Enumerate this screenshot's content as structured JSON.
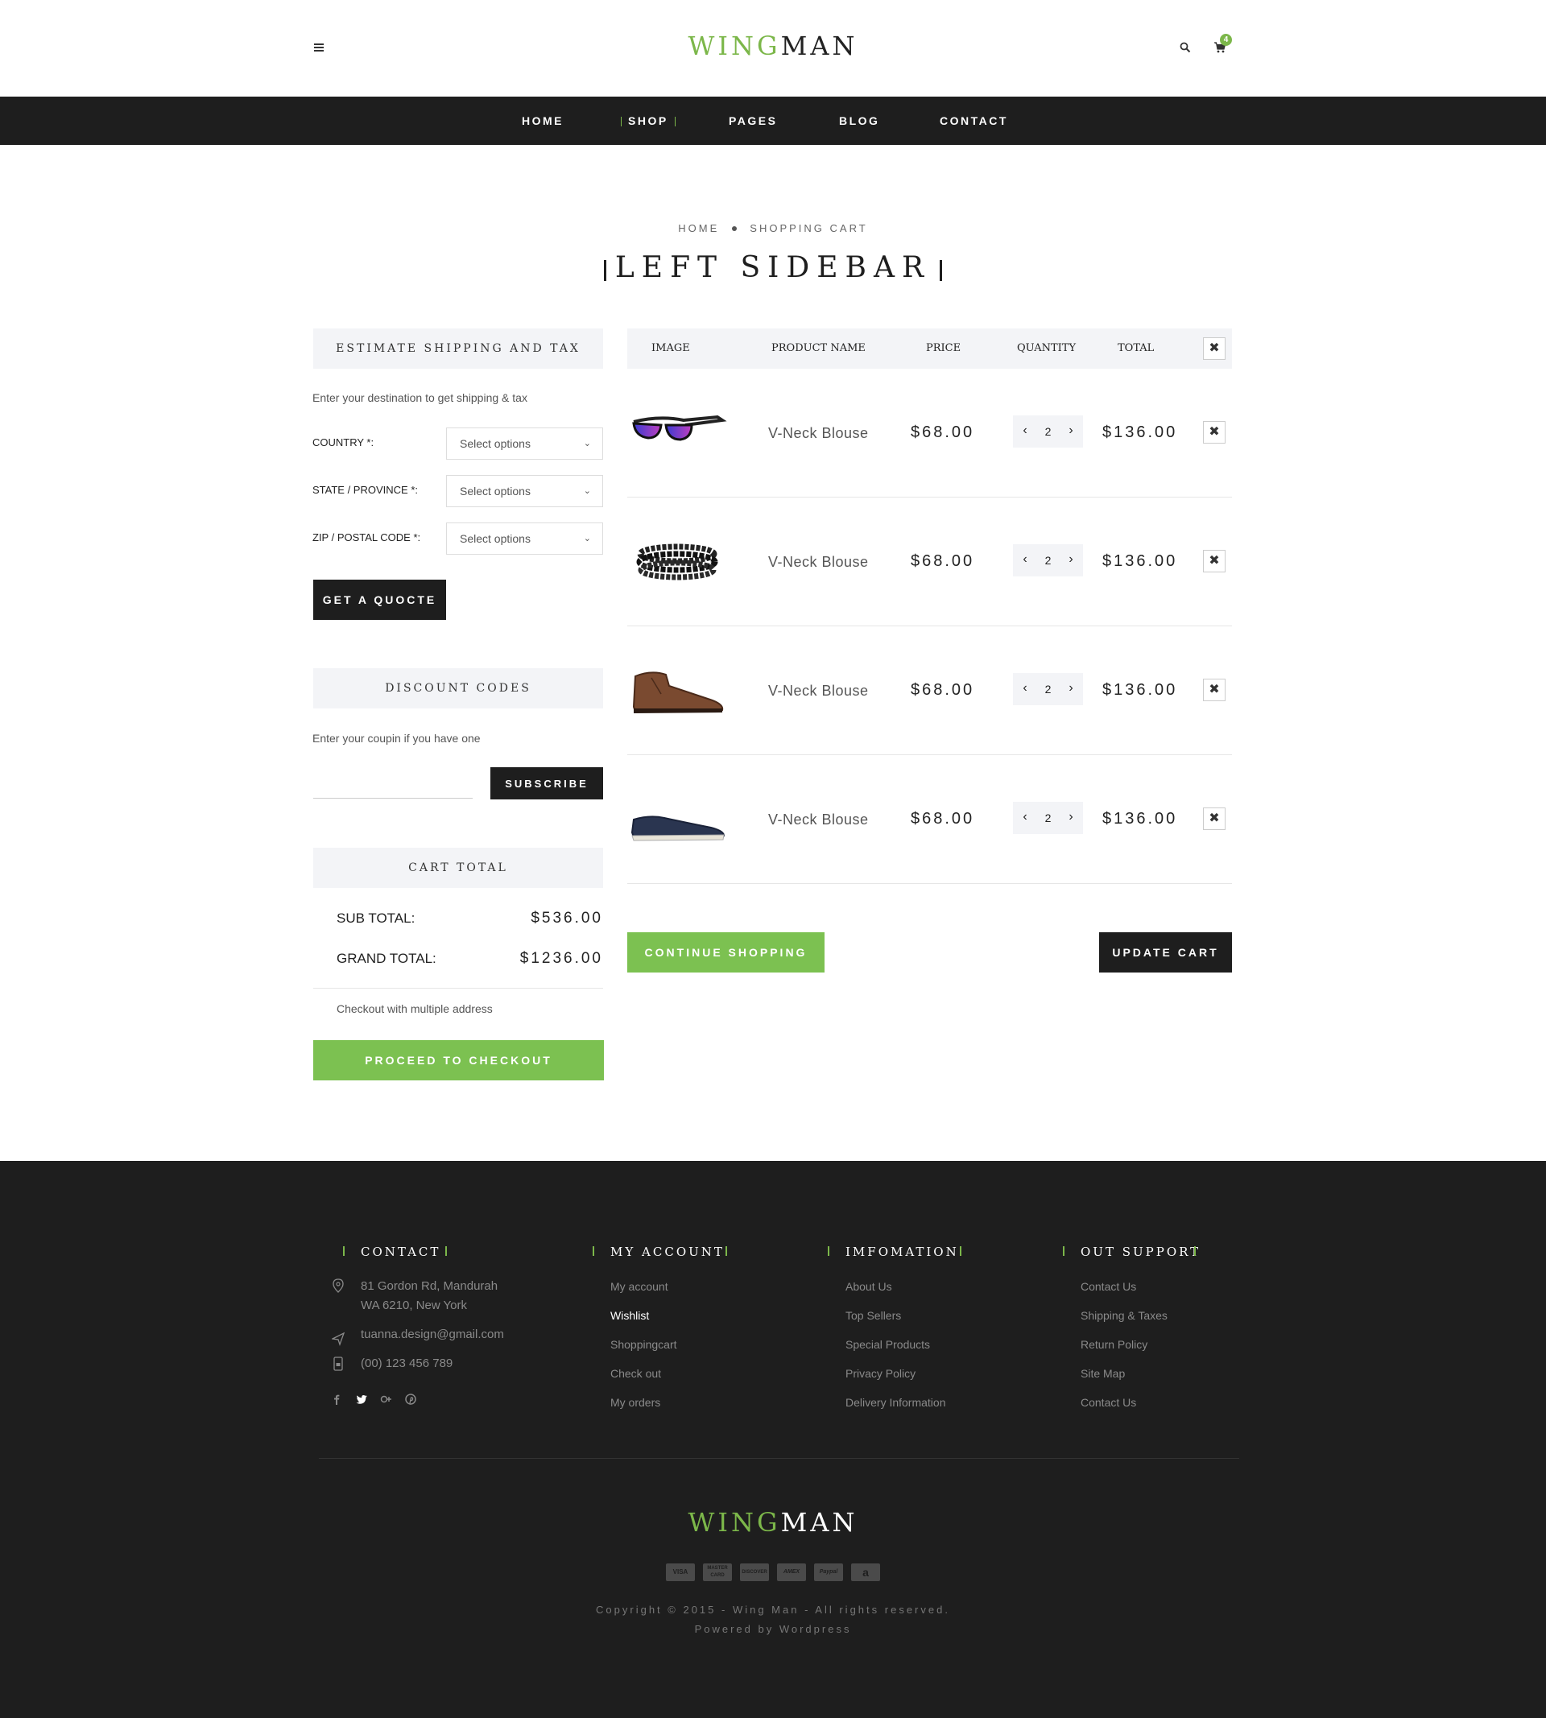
{
  "header": {
    "logo_green": "WING",
    "logo_dark": "MAN",
    "cart_count": "4",
    "nav": [
      "HOME",
      "SHOP",
      "PAGES",
      "BLOG",
      "CONTACT"
    ]
  },
  "breadcrumb": {
    "home": "HOME",
    "current": "SHOPPING CART"
  },
  "page_title": "LEFT SIDEBAR",
  "shipping": {
    "title": "ESTIMATE SHIPPING AND TAX",
    "intro": "Enter your destination to get shipping & tax",
    "country_label": "COUNTRY *:",
    "state_label": "STATE / PROVINCE *:",
    "zip_label": "ZIP / POSTAL CODE *:",
    "select_value": "Select options",
    "quote_button": "GET A QUOCTE"
  },
  "discount": {
    "title": "DISCOUNT CODES",
    "intro": "Enter your coupin if you have one",
    "button": "SUBSCRIBE"
  },
  "cart_total": {
    "title": "CART TOTAL",
    "sub_label": "SUB TOTAL:",
    "sub_value": "$536.00",
    "grand_label": "GRAND TOTAL:",
    "grand_value": "$1236.00",
    "multi_address": "Checkout with multiple address",
    "checkout_button": "PROCEED TO CHECKOUT"
  },
  "table": {
    "headers": {
      "image": "IMAGE",
      "product": "PRODUCT NAME",
      "price": "PRICE",
      "quantity": "QUANTITY",
      "total": "TOTAL"
    },
    "rows": [
      {
        "image": "sunglasses",
        "name": "V-Neck Blouse",
        "price": "$68.00",
        "quantity": "2",
        "total": "$136.00"
      },
      {
        "image": "bracelet",
        "name": "V-Neck Blouse",
        "price": "$68.00",
        "quantity": "2",
        "total": "$136.00"
      },
      {
        "image": "brown-boot",
        "name": "V-Neck Blouse",
        "price": "$68.00",
        "quantity": "2",
        "total": "$136.00"
      },
      {
        "image": "navy-sneaker",
        "name": "V-Neck Blouse",
        "price": "$68.00",
        "quantity": "2",
        "total": "$136.00"
      }
    ],
    "continue_button": "CONTINUE SHOPPING",
    "update_button": "UPDATE CART"
  },
  "footer": {
    "contact": {
      "title": "CONTACT",
      "address_line1": "81 Gordon Rd, Mandurah",
      "address_line2": "WA 6210, New York",
      "email": "tuanna.design@gmail.com",
      "phone": "(00) 123 456 789"
    },
    "account": {
      "title": "MY ACCOUNT",
      "links": [
        "My account",
        "Wishlist",
        "Shoppingcart",
        "Check out",
        "My orders"
      ]
    },
    "information": {
      "title": "IMFOMATION",
      "links": [
        "About Us",
        "Top Sellers",
        "Special Products",
        "Privacy Policy",
        "Delivery Information"
      ]
    },
    "support": {
      "title": "OUT SUPPORT",
      "links": [
        "Contact Us",
        "Shipping & Taxes",
        "Return Policy",
        "Site Map",
        "Contact Us"
      ]
    },
    "logo_green": "WING",
    "logo_light": "MAN",
    "payments": [
      "VISA",
      "MASTER CARD",
      "DISCOVER",
      "AMEX",
      "Paypal",
      "a"
    ],
    "copyright": "Copyright © 2015 - Wing Man - All rights reserved.",
    "powered": "Powered by Wordpress"
  },
  "colors": {
    "accent": "#7cb74a",
    "dark": "#1e1e1e",
    "panel": "#f3f4f7"
  }
}
